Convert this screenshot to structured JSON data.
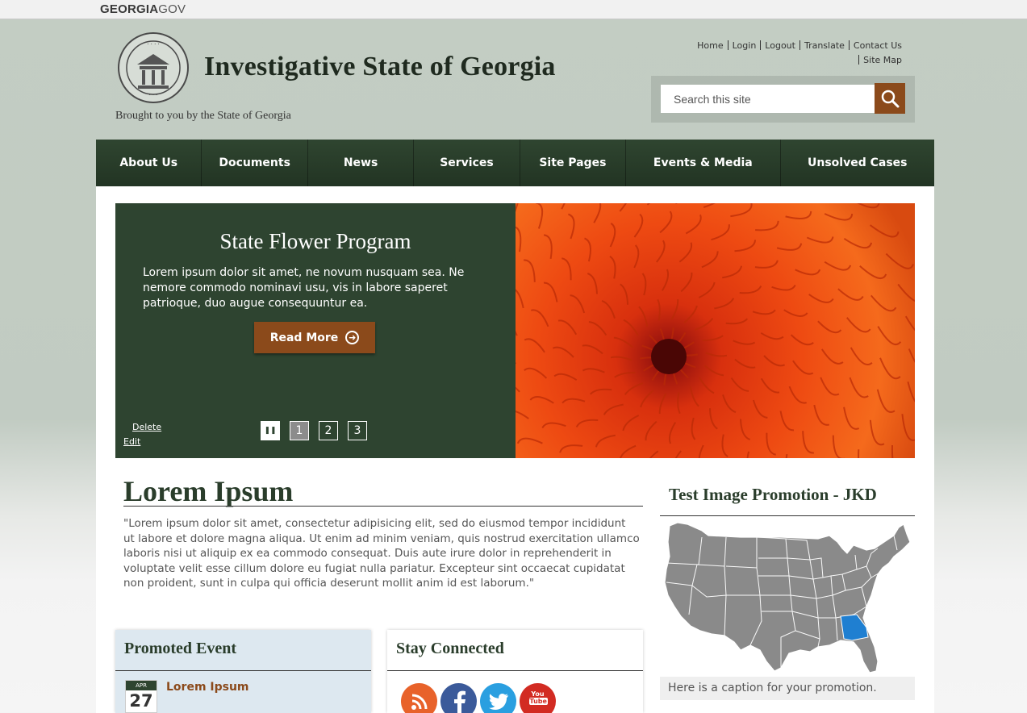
{
  "govbar": {
    "brand_bold": "GEORGIA",
    "brand_light": "GOV"
  },
  "header": {
    "title": "Investigative State of Georgia",
    "tagline": "Brought to you by the State of Georgia",
    "utility_links": [
      "Home",
      "Login",
      "Logout",
      "Translate",
      "Contact Us",
      "Site Map"
    ],
    "search": {
      "placeholder": "Search this site"
    }
  },
  "nav": {
    "items": [
      "About Us",
      "Documents",
      "News",
      "Services",
      "Site Pages",
      "Events & Media",
      "Unsolved Cases"
    ]
  },
  "hero": {
    "title": "State Flower Program",
    "text": "Lorem ipsum dolor sit amet, ne novum nusquam sea. Ne nemore commodo nominavi usu, vis in labore saperet patrioque, duo augue consequuntur ea.",
    "button_label": "Read More",
    "delete_label": "Delete",
    "edit_label": "Edit",
    "pager": [
      "1",
      "2",
      "3"
    ],
    "active_page": "1"
  },
  "main": {
    "title": "Lorem Ipsum",
    "body": "\"Lorem ipsum dolor sit amet, consectetur adipisicing elit, sed do eiusmod tempor incididunt ut labore et dolore magna aliqua. Ut enim ad minim veniam, quis nostrud exercitation ullamco laboris nisi ut aliquip ex ea commodo consequat. Duis aute irure dolor in reprehenderit in voluptate velit esse cillum dolore eu fugiat nulla pariatur. Excepteur sint occaecat cupidatat non proident, sunt in culpa qui officia deserunt mollit anim id est laborum.\""
  },
  "promoted_event": {
    "title": "Promoted Event",
    "month": "APR",
    "day": "27",
    "event_title": "Lorem Ipsum"
  },
  "stay_connected": {
    "title": "Stay Connected",
    "icons": [
      "rss-icon",
      "facebook-icon",
      "twitter-icon",
      "youtube-icon"
    ],
    "youtube_text_1": "You",
    "youtube_text_2": "Tube"
  },
  "promotion": {
    "title": "Test Image Promotion - JKD",
    "caption": "Here is a caption for your promotion."
  },
  "colors": {
    "dark_green": "#2e4430",
    "accent_brown": "#8b4a1b",
    "map_gray": "#8a8a8a",
    "georgia_blue": "#1f7fd1"
  }
}
